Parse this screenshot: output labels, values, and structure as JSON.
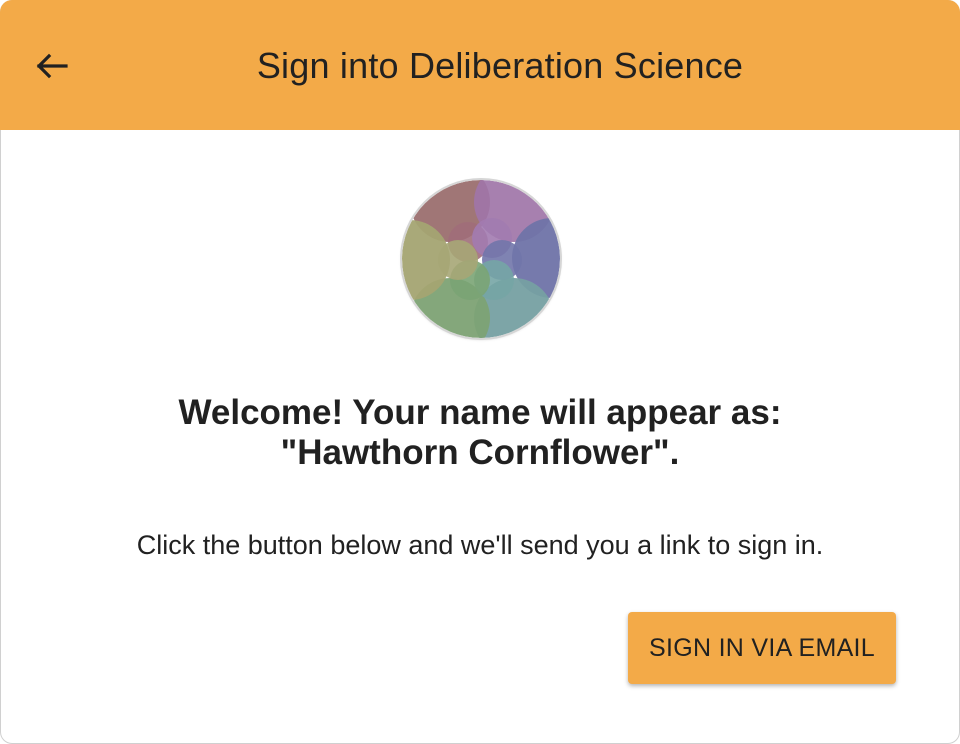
{
  "header": {
    "title": "Sign into Deliberation Science",
    "back_icon": "arrow-left-icon"
  },
  "logo": {
    "icon": "app-logo-icon",
    "colors": [
      "#9b6f6f",
      "#9f75a8",
      "#6f73a8",
      "#76a0a2",
      "#7da274",
      "#a4a472"
    ]
  },
  "welcome": {
    "line1": "Welcome! Your name will appear as:",
    "line2": "\"Hawthorn Cornflower\"."
  },
  "instructions": "Click the button below and we'll send you a link to sign in.",
  "actions": {
    "email_button_label": "SIGN IN VIA EMAIL"
  },
  "colors": {
    "accent": "#f3aa48",
    "text": "#212121",
    "background": "#ffffff"
  }
}
